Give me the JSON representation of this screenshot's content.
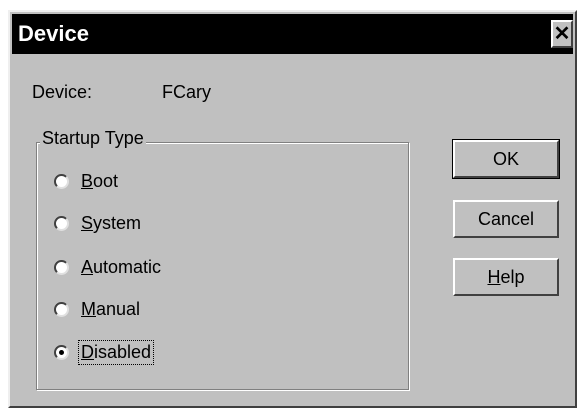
{
  "window": {
    "title": "Device",
    "close_glyph": "✕"
  },
  "device": {
    "label": "Device:",
    "value": "FCary"
  },
  "startup_type": {
    "legend": "Startup Type",
    "options": [
      {
        "mnemonic": "B",
        "rest": "oot",
        "selected": false
      },
      {
        "mnemonic": "S",
        "rest": "ystem",
        "selected": false
      },
      {
        "mnemonic": "A",
        "rest": "utomatic",
        "selected": false
      },
      {
        "mnemonic": "M",
        "rest": "anual",
        "selected": false
      },
      {
        "mnemonic": "D",
        "rest": "isabled",
        "selected": true
      }
    ]
  },
  "buttons": {
    "ok": "OK",
    "cancel": "Cancel",
    "help_mnemonic": "H",
    "help_rest": "elp"
  },
  "colors": {
    "face": "#c0c0c0",
    "titlebar": "#000000",
    "title_text": "#ffffff"
  },
  "icons": {
    "close": "close-icon",
    "radio_selected": "radio-selected-icon",
    "radio_unselected": "radio-unselected-icon"
  }
}
